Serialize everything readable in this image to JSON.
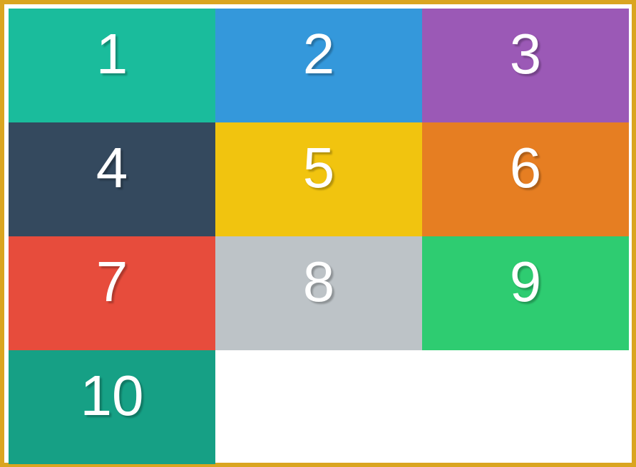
{
  "frame": {
    "border_color": "#DAA520",
    "background": "#FFFFFF"
  },
  "cells": [
    {
      "label": "1",
      "color": "#1ABC9C"
    },
    {
      "label": "2",
      "color": "#3498DB"
    },
    {
      "label": "3",
      "color": "#9B59B6"
    },
    {
      "label": "4",
      "color": "#34495E"
    },
    {
      "label": "5",
      "color": "#F1C40F"
    },
    {
      "label": "6",
      "color": "#E67E22"
    },
    {
      "label": "7",
      "color": "#E74C3C"
    },
    {
      "label": "8",
      "color": "#BDC3C7"
    },
    {
      "label": "9",
      "color": "#2ECC71"
    },
    {
      "label": "10",
      "color": "#16A085"
    }
  ]
}
